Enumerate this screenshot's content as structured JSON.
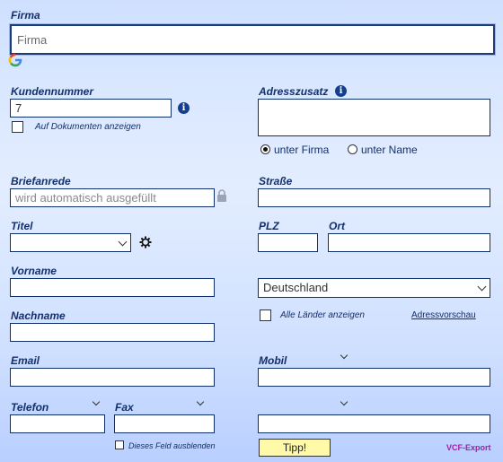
{
  "firma": {
    "label": "Firma",
    "placeholder": "Firma"
  },
  "kundennummer": {
    "label": "Kundennummer",
    "value": "7",
    "show_on_docs": "Auf Dokumenten anzeigen"
  },
  "adresszusatz": {
    "label": "Adresszusatz",
    "option_firma": "unter Firma",
    "option_name": "unter Name",
    "selected": "unter Firma"
  },
  "briefanrede": {
    "label": "Briefanrede",
    "placeholder": "wird automatisch ausgefüllt"
  },
  "strasse": {
    "label": "Straße"
  },
  "titel": {
    "label": "Titel"
  },
  "plz": {
    "label": "PLZ"
  },
  "ort": {
    "label": "Ort"
  },
  "vorname": {
    "label": "Vorname"
  },
  "land": {
    "value": "Deutschland"
  },
  "nachname": {
    "label": "Nachname"
  },
  "alle_laender": "Alle Länder anzeigen",
  "adressvorschau": "Adressvorschau",
  "email": {
    "label": "Email"
  },
  "mobil": {
    "label": "Mobil"
  },
  "telefon": {
    "label": "Telefon"
  },
  "fax": {
    "label": "Fax"
  },
  "hide_field": "Dieses Feld ausblenden",
  "tipp": "Tipp!",
  "vcf_export": "VCF-Export",
  "colors": {
    "accent": "#13306b",
    "tipp_bg": "#fff9a8",
    "vcf": "#a01cab"
  }
}
